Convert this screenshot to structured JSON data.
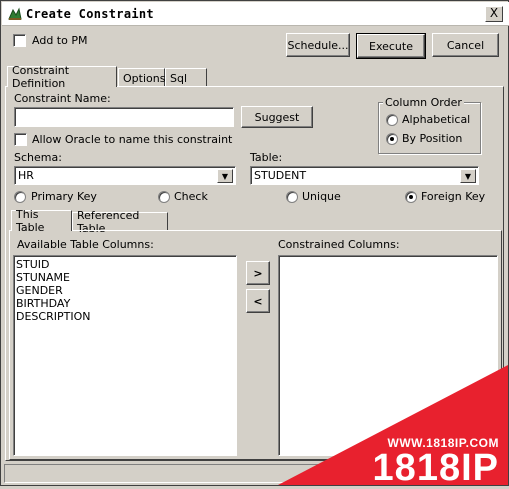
{
  "window": {
    "title": "Create Constraint",
    "close": "X"
  },
  "top": {
    "add_to_pm": "Add to PM",
    "schedule_label": "Schedule...",
    "execute_label": "Execute",
    "cancel_label": "Cancel"
  },
  "tabs": [
    {
      "label": "Constraint Definition"
    },
    {
      "label": "Options"
    },
    {
      "label": "Sql"
    }
  ],
  "form": {
    "constraint_name_label": "Constraint Name:",
    "constraint_name_value": "",
    "suggest_label": "Suggest",
    "allow_oracle_label": "Allow Oracle to name this constraint",
    "column_order": {
      "title": "Column Order",
      "alphabetical": "Alphabetical",
      "by_position": "By Position",
      "selected": "By Position"
    },
    "schema_label": "Schema:",
    "schema_value": "HR",
    "table_label": "Table:",
    "table_value": "STUDENT",
    "constraint_types": [
      "Primary Key",
      "Check",
      "Unique",
      "Foreign Key"
    ],
    "selected_type": "Foreign Key"
  },
  "subtabs": [
    {
      "label": "This Table"
    },
    {
      "label": "Referenced Table"
    }
  ],
  "columns": {
    "available_label": "Available Table Columns:",
    "available": [
      "STUID",
      "STUNAME",
      "GENDER",
      "BIRTHDAY",
      "DESCRIPTION"
    ],
    "constrained_label": "Constrained Columns:",
    "constrained": [],
    "add_label": ">",
    "remove_label": "<"
  },
  "watermark": {
    "url": "WWW.1818IP.COM",
    "brand": "1818IP"
  },
  "colors": {
    "face": "#d4d0c8",
    "watermark_red": "#e8212e"
  }
}
